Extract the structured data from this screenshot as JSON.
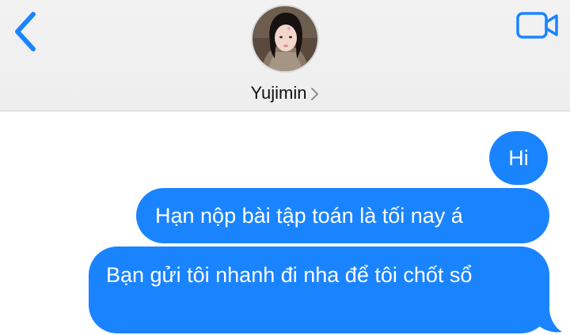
{
  "header": {
    "contact_name": "Yujimin",
    "accent_color": "#1a84ff"
  },
  "icons": {
    "back": "chevron-left-icon",
    "video": "video-camera-icon",
    "contact_chevron": "chevron-right-icon"
  },
  "messages": [
    {
      "sender": "me",
      "text": "Hi"
    },
    {
      "sender": "me",
      "text": "Hạn nộp bài tập toán là tối nay á"
    },
    {
      "sender": "me",
      "text": "Bạn gửi tôi nhanh đi nha để tôi chốt sổ"
    }
  ]
}
